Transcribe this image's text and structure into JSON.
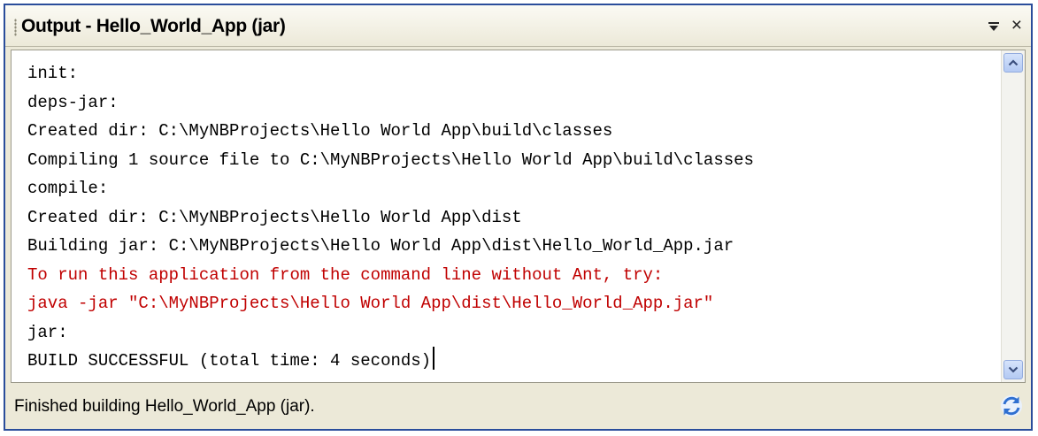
{
  "window": {
    "title": "Output - Hello_World_App (jar)",
    "menu_icon": "dropdown-menu-icon",
    "close_glyph": "×",
    "close_icon": "close-icon"
  },
  "output": {
    "lines": [
      {
        "text": "init:",
        "type": "normal"
      },
      {
        "text": "deps-jar:",
        "type": "normal"
      },
      {
        "text": "Created dir: C:\\MyNBProjects\\Hello World App\\build\\classes",
        "type": "normal"
      },
      {
        "text": "Compiling 1 source file to C:\\MyNBProjects\\Hello World App\\build\\classes",
        "type": "normal"
      },
      {
        "text": "compile:",
        "type": "normal"
      },
      {
        "text": "Created dir: C:\\MyNBProjects\\Hello World App\\dist",
        "type": "normal"
      },
      {
        "text": "Building jar: C:\\MyNBProjects\\Hello World App\\dist\\Hello_World_App.jar",
        "type": "normal"
      },
      {
        "text": "To run this application from the command line without Ant, try:",
        "type": "error"
      },
      {
        "text": "java -jar \"C:\\MyNBProjects\\Hello World App\\dist\\Hello_World_App.jar\"",
        "type": "error"
      },
      {
        "text": "jar:",
        "type": "normal"
      },
      {
        "text": "BUILD SUCCESSFUL (total time: 4 seconds)",
        "type": "normal"
      }
    ],
    "colors": {
      "normal": "#000000",
      "error": "#c00000"
    }
  },
  "scrollbar": {
    "up_icon": "scroll-up-arrow-icon",
    "down_icon": "scroll-down-arrow-icon"
  },
  "status": {
    "text": "Finished building Hello_World_App (jar).",
    "icon": "refresh-icon"
  },
  "colors": {
    "frame_border": "#2a4d9b",
    "panel_background": "#ece9d8",
    "scroll_button": "#c4d6f7"
  }
}
